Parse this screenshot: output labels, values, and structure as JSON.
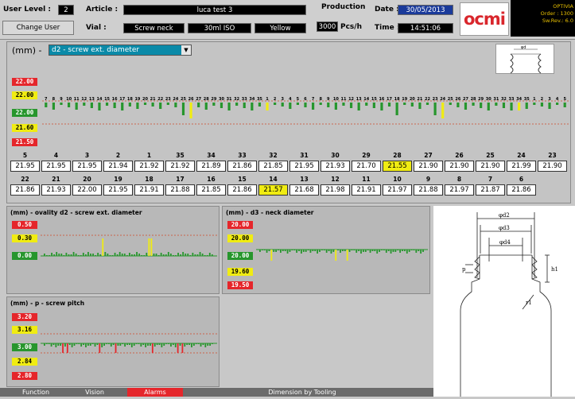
{
  "header": {
    "user_level_label": "User Level :",
    "user_level_value": "2",
    "change_user_label": "Change User",
    "article_label": "Article :",
    "article_value": "luca test 3",
    "vial_label": "Vial :",
    "vial_fields": [
      "Screw neck",
      "30ml ISO",
      "Yellow"
    ],
    "production_label": "Production",
    "production_value": "3000",
    "production_unit": "Pcs/h",
    "date_label": "Date :",
    "date_value": "30/05/2013",
    "time_label": "Time :",
    "time_value": "14:51:06",
    "logo_text": "ocmi",
    "info_lines": [
      "OPTIVIA",
      "Order : 1300",
      "Sw.Rev.: 6.0"
    ]
  },
  "main": {
    "unit_label": "(mm) -",
    "selected_measure": "d2 - screw ext. diameter",
    "limits": {
      "upper_red": "22.00",
      "upper_yellow": "22.00",
      "nominal": "22.00",
      "lower_yellow": "21.60",
      "lower_red": "21.50"
    },
    "axis_numbers": [
      "7",
      "8",
      "9",
      "10",
      "11",
      "12",
      "13",
      "14",
      "15",
      "16",
      "17",
      "18",
      "19",
      "20",
      "21",
      "22",
      "23",
      "24",
      "25",
      "26",
      "27",
      "28",
      "29",
      "30",
      "31",
      "32",
      "33",
      "34",
      "35",
      "1",
      "2",
      "3",
      "4",
      "5",
      "6",
      "7",
      "8",
      "9",
      "10",
      "11",
      "12",
      "13",
      "14",
      "15",
      "16",
      "17",
      "18",
      "19",
      "20",
      "21",
      "22",
      "23",
      "24",
      "25",
      "26",
      "27",
      "28",
      "29",
      "30",
      "31",
      "32",
      "33",
      "34",
      "35",
      "1",
      "2",
      "3",
      "4",
      "5"
    ],
    "row1_headers": [
      "5",
      "4",
      "3",
      "2",
      "1",
      "35",
      "34",
      "33",
      "32",
      "31",
      "30",
      "29",
      "28",
      "27",
      "26",
      "25",
      "24",
      "23"
    ],
    "row1_values": [
      "21.95",
      "21.95",
      "21.95",
      "21.94",
      "21.92",
      "21.92",
      "21.89",
      "21.86",
      "21.85",
      "21.95",
      "21.93",
      "21.70",
      "21.55",
      "21.90",
      "21.90",
      "21.90",
      "21.99",
      "21.90"
    ],
    "row1_highlight": [
      12
    ],
    "row2_headers": [
      "22",
      "21",
      "20",
      "19",
      "18",
      "17",
      "16",
      "15",
      "14",
      "13",
      "12",
      "11",
      "10",
      "9",
      "8",
      "7",
      "6"
    ],
    "row2_values": [
      "21.86",
      "21.93",
      "22.00",
      "21.95",
      "21.91",
      "21.88",
      "21.85",
      "21.86",
      "21.57",
      "21.68",
      "21.98",
      "21.91",
      "21.97",
      "21.88",
      "21.97",
      "21.87",
      "21.86"
    ],
    "row2_highlight": [
      8
    ]
  },
  "panels": {
    "ovality": {
      "title": "(mm) - ovality d2 - screw ext. diameter",
      "tags": [
        "0.50",
        "0.30",
        "0.00"
      ]
    },
    "neck": {
      "title": "(mm) - d3 - neck diameter",
      "tags": [
        "20.00",
        "20.00",
        "20.00",
        "19.60",
        "19.50"
      ]
    },
    "pitch": {
      "title": "(mm) - p - screw pitch",
      "tags": [
        "3.20",
        "3.16",
        "3.00",
        "2.84",
        "2.80"
      ]
    }
  },
  "drawing": {
    "labels": [
      "φd2",
      "φd3",
      "φd4",
      "p",
      "h1",
      "r1"
    ]
  },
  "tabs": [
    "Function",
    "Vision",
    "Alarms",
    "Dimension by Tooling"
  ],
  "colors": {
    "red": "#e5262b",
    "yellow": "#f0ec12",
    "green": "#27962d",
    "alarm_tab": "#e5262b"
  }
}
